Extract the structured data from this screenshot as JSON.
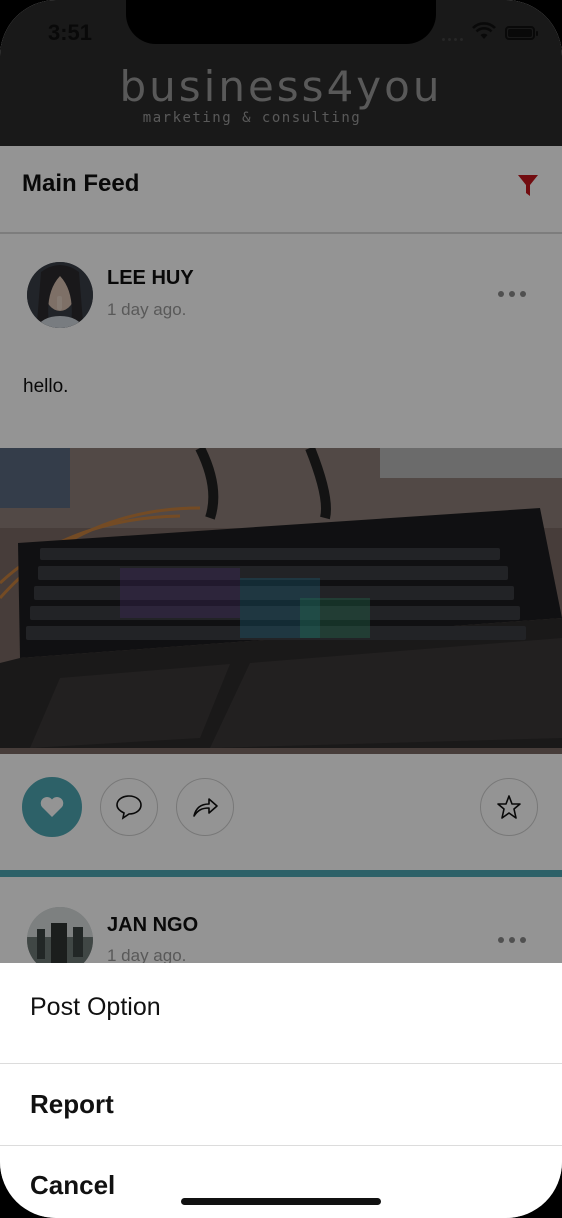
{
  "status_bar": {
    "time": "3:51"
  },
  "header": {
    "brand_name": "business4you",
    "brand_tagline": "marketing & consulting"
  },
  "feed": {
    "title": "Main Feed",
    "filter_color": "#c4151c"
  },
  "posts": [
    {
      "author": "LEE HUY",
      "time_ago": "1 day ago.",
      "text": "hello."
    },
    {
      "author": "JAN NGO",
      "time_ago": "1 day ago."
    }
  ],
  "action_sheet": {
    "title": "Post Option",
    "items": [
      "Report",
      "Cancel"
    ]
  },
  "colors": {
    "accent": "#4ea7b3",
    "header_bg": "#2b2b2b"
  }
}
